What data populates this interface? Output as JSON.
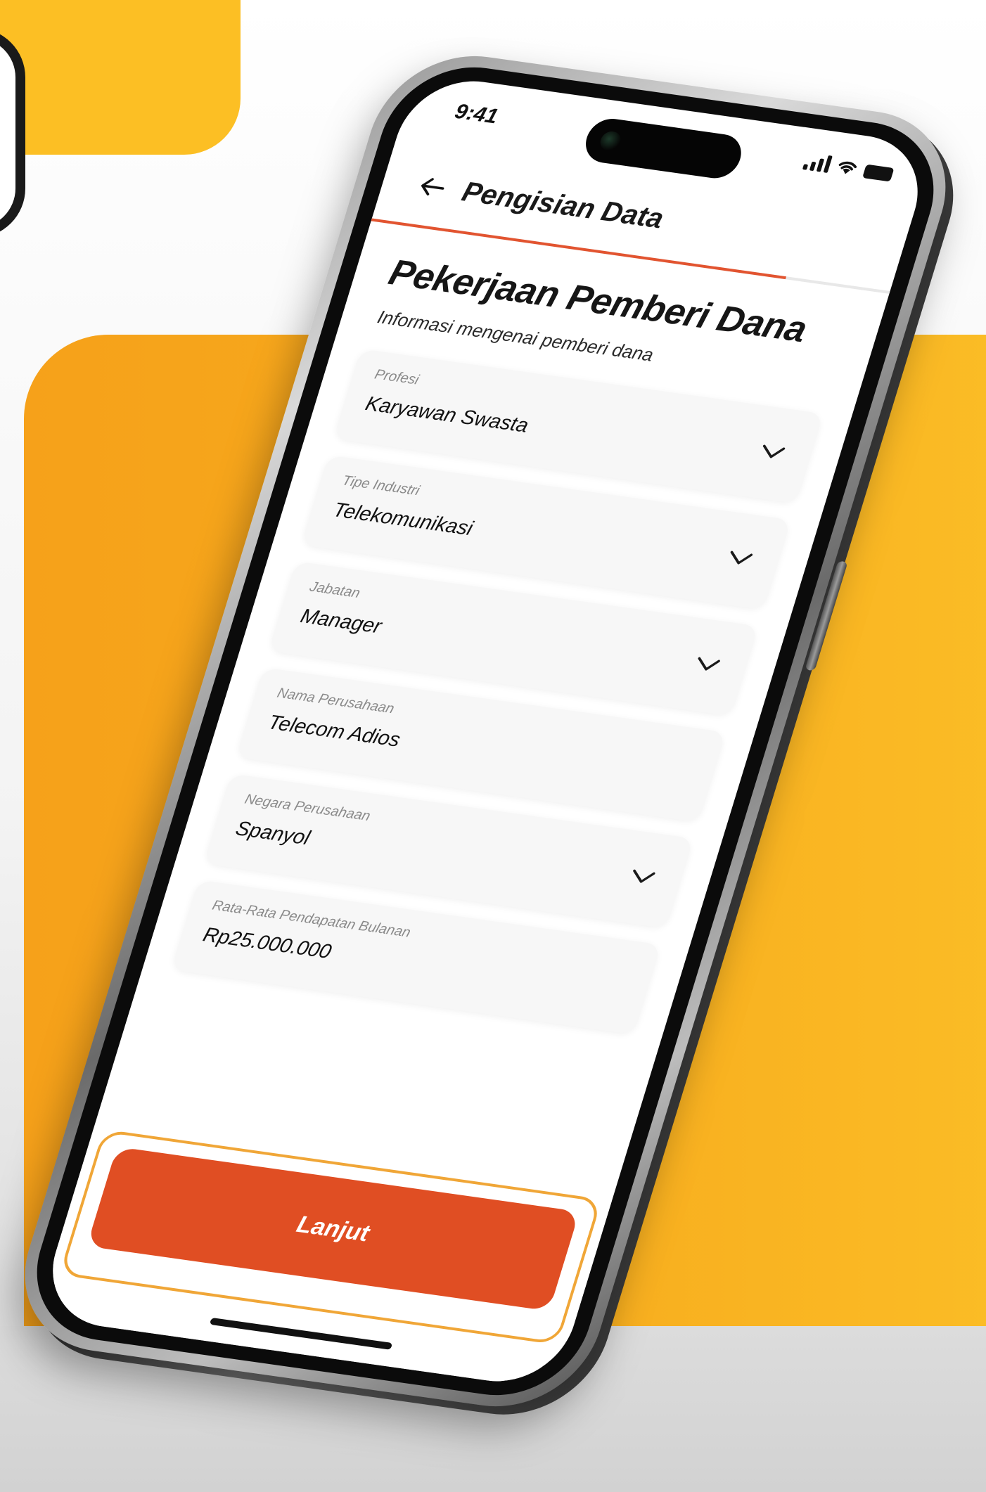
{
  "status_bar": {
    "time": "9:41"
  },
  "header": {
    "title": "Pengisian Data",
    "back_icon": "arrow-left-icon",
    "progress": 0.8
  },
  "page": {
    "heading": "Pekerjaan Pemberi Dana",
    "subheading": "Informasi mengenai pemberi dana"
  },
  "form": {
    "fields": [
      {
        "label": "Profesi",
        "value": "Karyawan Swasta",
        "has_dropdown": true
      },
      {
        "label": "Tipe Industri",
        "value": "Telekomunikasi",
        "has_dropdown": true
      },
      {
        "label": "Jabatan",
        "value": "Manager",
        "has_dropdown": true
      },
      {
        "label": "Nama Perusahaan",
        "value": "Telecom Adios",
        "has_dropdown": false
      },
      {
        "label": "Negara Perusahaan",
        "value": "Spanyol",
        "has_dropdown": true
      },
      {
        "label": "Rata-Rata Pendapatan Bulanan",
        "value": "Rp25.000.000",
        "has_dropdown": false
      }
    ]
  },
  "cta": {
    "label": "Lanjut"
  },
  "colors": {
    "accent": "#e04e23",
    "accent_outline": "#f0a637",
    "background_orange": "#f6a11a",
    "background_yellow": "#fcbf24"
  }
}
